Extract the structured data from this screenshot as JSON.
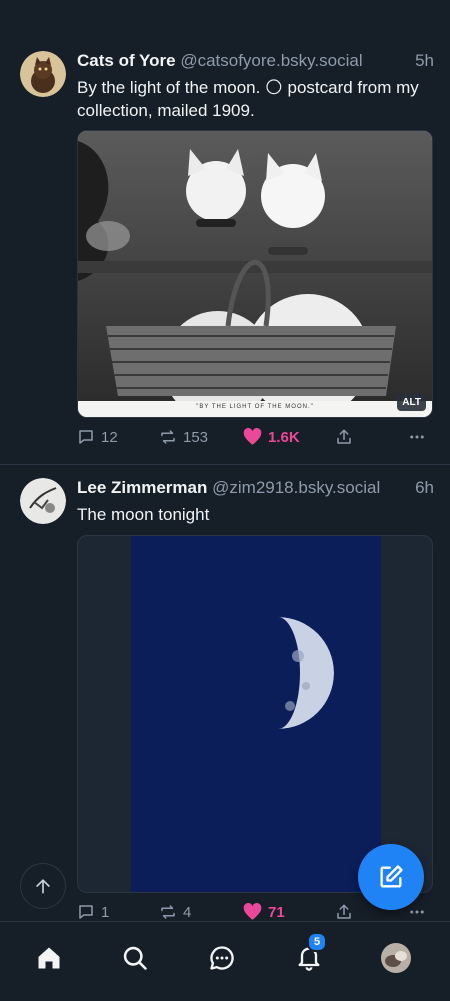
{
  "posts": [
    {
      "author": "Cats of Yore",
      "handle": "@catsofyore.bsky.social",
      "time": "5h",
      "text": "By the light of the moon. 🌕 postcard from my collection, mailed 1909.",
      "image_caption": "\"BY THE LIGHT OF THE MOON.\"",
      "alt_badge": "ALT",
      "replies": "12",
      "reposts": "153",
      "likes": "1.6K",
      "liked": true
    },
    {
      "author": "Lee Zimmerman",
      "handle": "@zim2918.bsky.social",
      "time": "6h",
      "text": "The moon tonight",
      "replies": "1",
      "reposts": "4",
      "likes": "71",
      "liked": true
    }
  ],
  "nav": {
    "notifications_badge": "5",
    "items": [
      "home-icon",
      "search-icon",
      "chat-icon",
      "bell-icon",
      "profile-avatar"
    ]
  },
  "colors": {
    "background": "#161e27",
    "accent": "#1f83f6",
    "like": "#ec4899",
    "muted": "#8d9bab"
  }
}
